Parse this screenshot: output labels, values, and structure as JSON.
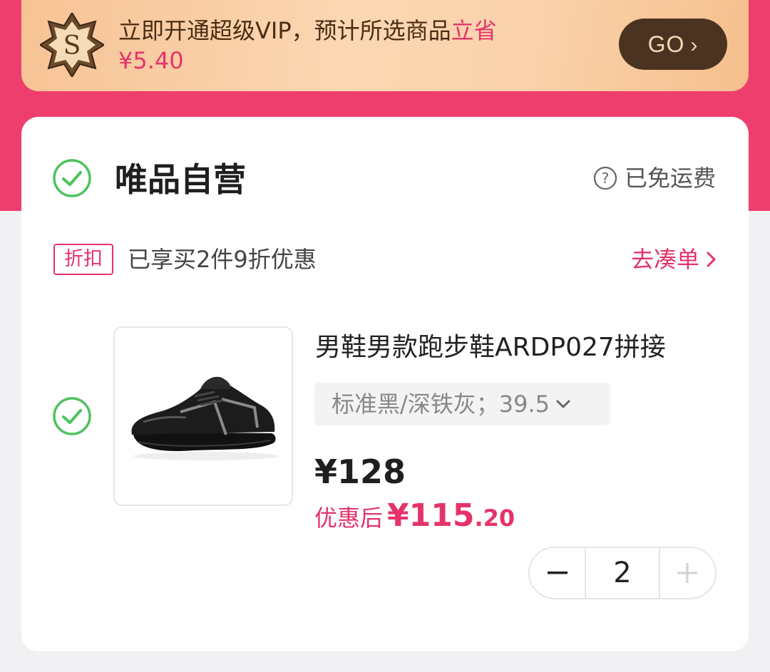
{
  "vip_banner": {
    "text": "立即开通超级VIP，预计所选商品",
    "highlight": "立省",
    "amount": "¥5.40",
    "go_label": "GO",
    "emblem_letter": "S",
    "emblem_icon": "vip-badge-icon"
  },
  "store": {
    "name": "唯品自营",
    "selected": true,
    "shipping_label": "已免运费",
    "shipping_icon": "question-circle-icon"
  },
  "promo": {
    "tag": "折扣",
    "text": "已享买2件9折优惠",
    "link": "去凑单"
  },
  "product": {
    "selected": true,
    "title": "男鞋男款跑步鞋ARDP027拼接",
    "spec": "标准黑/深铁灰；39.5",
    "price": "¥128",
    "after_label": "优惠后",
    "after_currency": "¥",
    "after_int": "115",
    "after_dec": ".20",
    "quantity": "2",
    "image_icon": "shoe-thumbnail"
  },
  "colors": {
    "brand_pink": "#ee3e6d",
    "accent_red": "#e5336a",
    "check_green": "#4cc35c",
    "go_button": "#4a3320"
  }
}
